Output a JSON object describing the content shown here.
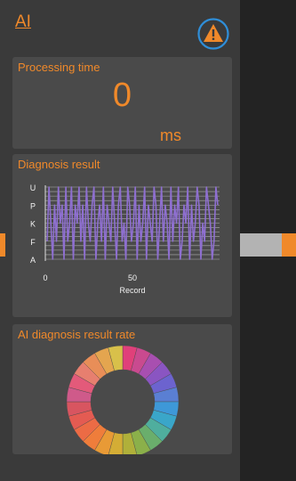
{
  "header": {
    "title": "AI",
    "warning_icon": "warning-triangle-icon"
  },
  "processing_time": {
    "title": "Processing time",
    "value": "0",
    "unit": "ms"
  },
  "diagnosis_result": {
    "title": "Diagnosis result"
  },
  "result_rate": {
    "title": "AI diagnosis result rate"
  },
  "colors": {
    "accent": "#f0892a",
    "panel_bg": "#3a3a3a",
    "card_bg": "#4a4a4a",
    "series": "#8e6fd0",
    "warning_ring": "#2f8ed8"
  },
  "chart_data": [
    {
      "type": "line",
      "title": "Diagnosis result",
      "xlabel": "Record",
      "ylabel": "",
      "y_categories": [
        "A",
        "F",
        "K",
        "P",
        "U"
      ],
      "xticks": [
        0,
        50
      ],
      "xlim": [
        0,
        100
      ],
      "grid": true,
      "series": [
        {
          "values": [
            1,
            4,
            2,
            0,
            3,
            1,
            4,
            2,
            3,
            0,
            4,
            1,
            2,
            4,
            0,
            3,
            2,
            4,
            1,
            3,
            0,
            4,
            2,
            1,
            3,
            4,
            0,
            2,
            3,
            1,
            4,
            0,
            3,
            2,
            1,
            4,
            2,
            0,
            3,
            4,
            1,
            2,
            0,
            4,
            3,
            1,
            2,
            4,
            0,
            3,
            1,
            2,
            4,
            0,
            3,
            2,
            1,
            4,
            3,
            0,
            2,
            4,
            1,
            3,
            2,
            0,
            4,
            1,
            3,
            2,
            4,
            0,
            1,
            3,
            2,
            4,
            0,
            3,
            1,
            2,
            4,
            3,
            0,
            2,
            1,
            4,
            3,
            2,
            0,
            1,
            4,
            3
          ]
        }
      ]
    },
    {
      "type": "pie",
      "title": "AI diagnosis result rate",
      "donut": true,
      "slice_count": 24,
      "values": [
        1,
        1,
        1,
        1,
        1,
        1,
        1,
        1,
        1,
        1,
        1,
        1,
        1,
        1,
        1,
        1,
        1,
        1,
        1,
        1,
        1,
        1,
        1,
        1
      ],
      "colors": [
        "#e0407a",
        "#c94a8f",
        "#a84fb0",
        "#8a55c2",
        "#6c63cf",
        "#5a7fd3",
        "#3e98d8",
        "#3aa6c9",
        "#4fae9e",
        "#6aae6c",
        "#8bb04a",
        "#b0b03a",
        "#d4ad35",
        "#e89a36",
        "#ef7d3b",
        "#ec6b45",
        "#e45b52",
        "#d85560",
        "#cf5a8a",
        "#e35a7a",
        "#e77f6f",
        "#e88e58",
        "#e4a54f",
        "#d8c04a"
      ]
    }
  ]
}
